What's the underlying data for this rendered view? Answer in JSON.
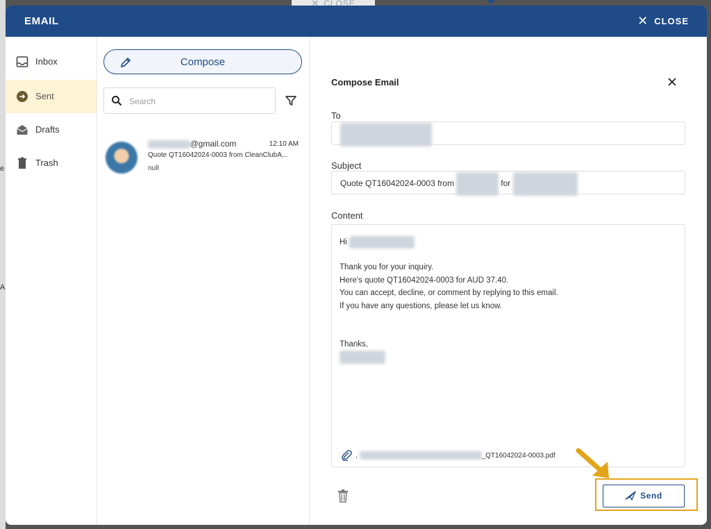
{
  "background": {
    "tab_label": "CLOSE",
    "edge_letters": [
      "e",
      "A"
    ]
  },
  "header": {
    "title": "EMAIL",
    "close_label": "CLOSE"
  },
  "nav": {
    "items": [
      {
        "label": "Inbox",
        "icon": "inbox-icon"
      },
      {
        "label": "Sent",
        "icon": "sent-icon",
        "active": true
      },
      {
        "label": "Drafts",
        "icon": "drafts-icon"
      },
      {
        "label": "Trash",
        "icon": "trash-icon"
      }
    ]
  },
  "list": {
    "compose_label": "Compose",
    "search_placeholder": "Search",
    "items": [
      {
        "from_domain": "@gmail.com",
        "time": "12:10 AM",
        "subject": "Quote QT16042024-0003 from CleanClubA...",
        "preview": "null"
      }
    ]
  },
  "compose": {
    "heading": "Compose Email",
    "to_label": "To",
    "subject_label": "Subject",
    "subject_prefix": "Quote QT16042024-0003 from",
    "subject_mid": "for",
    "content_label": "Content",
    "greeting": "Hi",
    "body_lines": [
      "Thank you for your inquiry.",
      "Here's quote QT16042024-0003 for AUD 37.40.",
      "You can accept, decline, or comment by replying to this email.",
      "If you have any questions, please let us know."
    ],
    "signoff": "Thanks,",
    "attachment_prefix": ",",
    "attachment_suffix": "_QT16042024-0003.pdf",
    "send_label": "Send"
  },
  "colors": {
    "brand": "#1f4b87",
    "active_nav": "#fdf3d5",
    "highlight": "#e2a51a"
  }
}
